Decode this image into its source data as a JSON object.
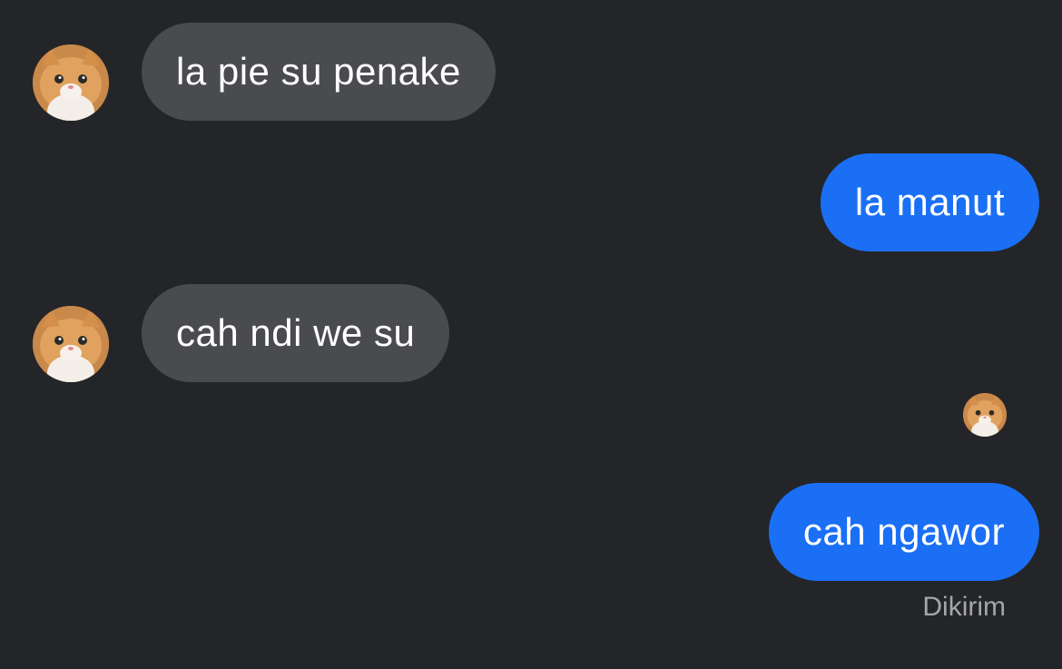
{
  "conversation": {
    "messages": [
      {
        "direction": "received",
        "text": "la pie su penake",
        "avatar": "cat-avatar"
      },
      {
        "direction": "sent",
        "text": "la manut"
      },
      {
        "direction": "received",
        "text": "cah ndi we su",
        "avatar": "cat-avatar"
      },
      {
        "direction": "sent",
        "text": "cah ngawor"
      }
    ],
    "status_text": "Dikirim",
    "read_receipt_avatar": "cat-avatar"
  },
  "colors": {
    "background": "#242528",
    "received_bubble": "#4a4b4f",
    "sent_bubble": "#1a6ff5",
    "status_text": "#a5a6aa"
  }
}
